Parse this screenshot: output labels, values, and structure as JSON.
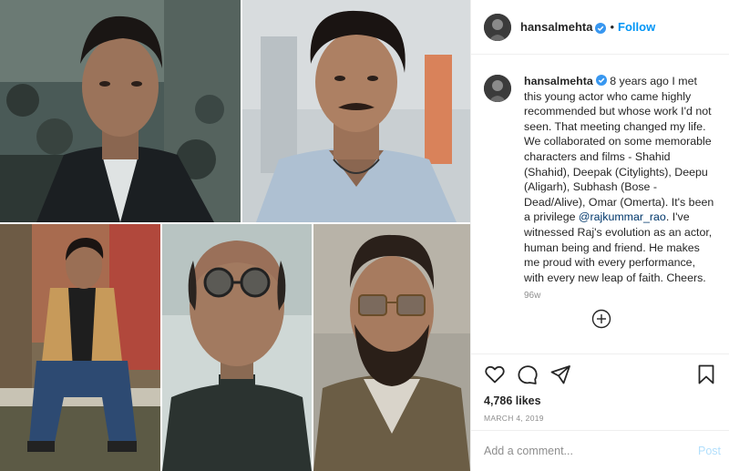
{
  "post": {
    "username": "hansalmehta",
    "dot": "•",
    "follow_label": "Follow",
    "caption": {
      "username": "hansalmehta",
      "text_before_mention": "8 years ago I met this young actor who came highly recommended but whose work I'd not seen. That meeting changed my life. We collaborated on some memorable characters and films - Shahid (Shahid), Deepak (Citylights), Deepu (Aligarh), Subhash (Bose -Dead/Alive), Omar (Omerta). It's been a privilege ",
      "mention": "@rajkummar_rao",
      "text_after_mention": ". I've witnessed Raj's evolution as an actor, human being and friend. He makes me proud with every performance, with every new leap of faith. Cheers.",
      "time_ago": "96w"
    },
    "likes": "4,786 likes",
    "date": "MARCH 4, 2019",
    "comment": {
      "placeholder": "Add a comment...",
      "value": "",
      "post_label": "Post"
    }
  },
  "icons": {
    "verified": "verified-badge-icon",
    "load_more": "plus-circle-icon",
    "like": "heart-icon",
    "comment": "comment-icon",
    "share": "paper-plane-icon",
    "save": "bookmark-icon"
  },
  "colors": {
    "accent": "#0095f6",
    "mention": "#00376b",
    "muted": "#8e8e8e",
    "post_disabled": "#b2dffc",
    "divider": "#efefef"
  }
}
